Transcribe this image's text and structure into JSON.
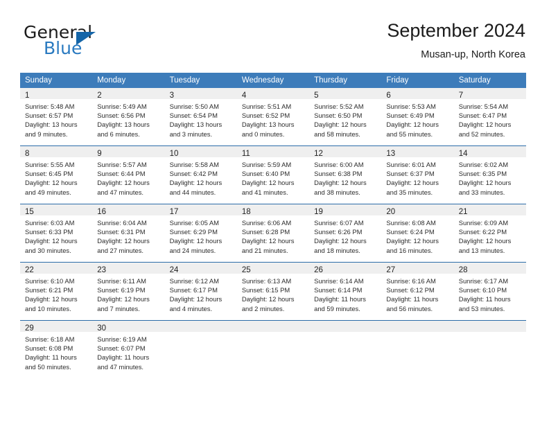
{
  "brand": {
    "name_part1": "General",
    "name_part2": "Blue",
    "triangle_icon": "triangle-icon",
    "accent_color": "#2a7ac0"
  },
  "header": {
    "title": "September 2024",
    "subtitle": "Musan-up, North Korea"
  },
  "theme": {
    "header_blue": "#3d7cba",
    "separator_blue": "#2b6ca8",
    "daynum_band": "#efefef"
  },
  "weekday_headers": [
    "Sunday",
    "Monday",
    "Tuesday",
    "Wednesday",
    "Thursday",
    "Friday",
    "Saturday"
  ],
  "weeks": [
    [
      {
        "day": "1",
        "sunrise": "Sunrise: 5:48 AM",
        "sunset": "Sunset: 6:57 PM",
        "daylight1": "Daylight: 13 hours",
        "daylight2": "and 9 minutes."
      },
      {
        "day": "2",
        "sunrise": "Sunrise: 5:49 AM",
        "sunset": "Sunset: 6:56 PM",
        "daylight1": "Daylight: 13 hours",
        "daylight2": "and 6 minutes."
      },
      {
        "day": "3",
        "sunrise": "Sunrise: 5:50 AM",
        "sunset": "Sunset: 6:54 PM",
        "daylight1": "Daylight: 13 hours",
        "daylight2": "and 3 minutes."
      },
      {
        "day": "4",
        "sunrise": "Sunrise: 5:51 AM",
        "sunset": "Sunset: 6:52 PM",
        "daylight1": "Daylight: 13 hours",
        "daylight2": "and 0 minutes."
      },
      {
        "day": "5",
        "sunrise": "Sunrise: 5:52 AM",
        "sunset": "Sunset: 6:50 PM",
        "daylight1": "Daylight: 12 hours",
        "daylight2": "and 58 minutes."
      },
      {
        "day": "6",
        "sunrise": "Sunrise: 5:53 AM",
        "sunset": "Sunset: 6:49 PM",
        "daylight1": "Daylight: 12 hours",
        "daylight2": "and 55 minutes."
      },
      {
        "day": "7",
        "sunrise": "Sunrise: 5:54 AM",
        "sunset": "Sunset: 6:47 PM",
        "daylight1": "Daylight: 12 hours",
        "daylight2": "and 52 minutes."
      }
    ],
    [
      {
        "day": "8",
        "sunrise": "Sunrise: 5:55 AM",
        "sunset": "Sunset: 6:45 PM",
        "daylight1": "Daylight: 12 hours",
        "daylight2": "and 49 minutes."
      },
      {
        "day": "9",
        "sunrise": "Sunrise: 5:57 AM",
        "sunset": "Sunset: 6:44 PM",
        "daylight1": "Daylight: 12 hours",
        "daylight2": "and 47 minutes."
      },
      {
        "day": "10",
        "sunrise": "Sunrise: 5:58 AM",
        "sunset": "Sunset: 6:42 PM",
        "daylight1": "Daylight: 12 hours",
        "daylight2": "and 44 minutes."
      },
      {
        "day": "11",
        "sunrise": "Sunrise: 5:59 AM",
        "sunset": "Sunset: 6:40 PM",
        "daylight1": "Daylight: 12 hours",
        "daylight2": "and 41 minutes."
      },
      {
        "day": "12",
        "sunrise": "Sunrise: 6:00 AM",
        "sunset": "Sunset: 6:38 PM",
        "daylight1": "Daylight: 12 hours",
        "daylight2": "and 38 minutes."
      },
      {
        "day": "13",
        "sunrise": "Sunrise: 6:01 AM",
        "sunset": "Sunset: 6:37 PM",
        "daylight1": "Daylight: 12 hours",
        "daylight2": "and 35 minutes."
      },
      {
        "day": "14",
        "sunrise": "Sunrise: 6:02 AM",
        "sunset": "Sunset: 6:35 PM",
        "daylight1": "Daylight: 12 hours",
        "daylight2": "and 33 minutes."
      }
    ],
    [
      {
        "day": "15",
        "sunrise": "Sunrise: 6:03 AM",
        "sunset": "Sunset: 6:33 PM",
        "daylight1": "Daylight: 12 hours",
        "daylight2": "and 30 minutes."
      },
      {
        "day": "16",
        "sunrise": "Sunrise: 6:04 AM",
        "sunset": "Sunset: 6:31 PM",
        "daylight1": "Daylight: 12 hours",
        "daylight2": "and 27 minutes."
      },
      {
        "day": "17",
        "sunrise": "Sunrise: 6:05 AM",
        "sunset": "Sunset: 6:29 PM",
        "daylight1": "Daylight: 12 hours",
        "daylight2": "and 24 minutes."
      },
      {
        "day": "18",
        "sunrise": "Sunrise: 6:06 AM",
        "sunset": "Sunset: 6:28 PM",
        "daylight1": "Daylight: 12 hours",
        "daylight2": "and 21 minutes."
      },
      {
        "day": "19",
        "sunrise": "Sunrise: 6:07 AM",
        "sunset": "Sunset: 6:26 PM",
        "daylight1": "Daylight: 12 hours",
        "daylight2": "and 18 minutes."
      },
      {
        "day": "20",
        "sunrise": "Sunrise: 6:08 AM",
        "sunset": "Sunset: 6:24 PM",
        "daylight1": "Daylight: 12 hours",
        "daylight2": "and 16 minutes."
      },
      {
        "day": "21",
        "sunrise": "Sunrise: 6:09 AM",
        "sunset": "Sunset: 6:22 PM",
        "daylight1": "Daylight: 12 hours",
        "daylight2": "and 13 minutes."
      }
    ],
    [
      {
        "day": "22",
        "sunrise": "Sunrise: 6:10 AM",
        "sunset": "Sunset: 6:21 PM",
        "daylight1": "Daylight: 12 hours",
        "daylight2": "and 10 minutes."
      },
      {
        "day": "23",
        "sunrise": "Sunrise: 6:11 AM",
        "sunset": "Sunset: 6:19 PM",
        "daylight1": "Daylight: 12 hours",
        "daylight2": "and 7 minutes."
      },
      {
        "day": "24",
        "sunrise": "Sunrise: 6:12 AM",
        "sunset": "Sunset: 6:17 PM",
        "daylight1": "Daylight: 12 hours",
        "daylight2": "and 4 minutes."
      },
      {
        "day": "25",
        "sunrise": "Sunrise: 6:13 AM",
        "sunset": "Sunset: 6:15 PM",
        "daylight1": "Daylight: 12 hours",
        "daylight2": "and 2 minutes."
      },
      {
        "day": "26",
        "sunrise": "Sunrise: 6:14 AM",
        "sunset": "Sunset: 6:14 PM",
        "daylight1": "Daylight: 11 hours",
        "daylight2": "and 59 minutes."
      },
      {
        "day": "27",
        "sunrise": "Sunrise: 6:16 AM",
        "sunset": "Sunset: 6:12 PM",
        "daylight1": "Daylight: 11 hours",
        "daylight2": "and 56 minutes."
      },
      {
        "day": "28",
        "sunrise": "Sunrise: 6:17 AM",
        "sunset": "Sunset: 6:10 PM",
        "daylight1": "Daylight: 11 hours",
        "daylight2": "and 53 minutes."
      }
    ],
    [
      {
        "day": "29",
        "sunrise": "Sunrise: 6:18 AM",
        "sunset": "Sunset: 6:08 PM",
        "daylight1": "Daylight: 11 hours",
        "daylight2": "and 50 minutes."
      },
      {
        "day": "30",
        "sunrise": "Sunrise: 6:19 AM",
        "sunset": "Sunset: 6:07 PM",
        "daylight1": "Daylight: 11 hours",
        "daylight2": "and 47 minutes."
      },
      {
        "day": "",
        "sunrise": "",
        "sunset": "",
        "daylight1": "",
        "daylight2": ""
      },
      {
        "day": "",
        "sunrise": "",
        "sunset": "",
        "daylight1": "",
        "daylight2": ""
      },
      {
        "day": "",
        "sunrise": "",
        "sunset": "",
        "daylight1": "",
        "daylight2": ""
      },
      {
        "day": "",
        "sunrise": "",
        "sunset": "",
        "daylight1": "",
        "daylight2": ""
      },
      {
        "day": "",
        "sunrise": "",
        "sunset": "",
        "daylight1": "",
        "daylight2": ""
      }
    ]
  ]
}
